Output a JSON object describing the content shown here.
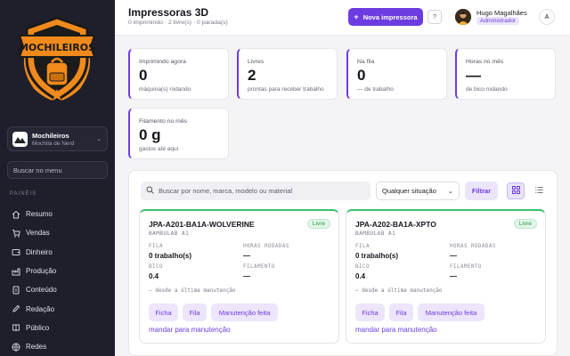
{
  "sidebar": {
    "logo_text": "MOCHILEIROS",
    "workspace_name": "Mochileiros",
    "workspace_sub": "Mochila de Nerd",
    "search_placeholder": "Buscar no menu",
    "section_label": "PAINÉIS",
    "items": [
      {
        "label": "Resumo",
        "icon": "home-icon"
      },
      {
        "label": "Vendas",
        "icon": "cart-icon"
      },
      {
        "label": "Dinheiro",
        "icon": "wallet-icon"
      },
      {
        "label": "Produção",
        "icon": "factory-icon"
      },
      {
        "label": "Conteúdo",
        "icon": "document-icon"
      },
      {
        "label": "Redação",
        "icon": "pencil-icon"
      },
      {
        "label": "Público",
        "icon": "book-icon"
      },
      {
        "label": "Redes",
        "icon": "globe-icon"
      }
    ]
  },
  "header": {
    "title": "Impressoras 3D",
    "subtitle": "0 imprimindo · 2 livre(s) · 0 parada(s)",
    "new_button": "Nova impressora",
    "user_name": "Hugo Magalhães",
    "user_role": "Administrador",
    "lang": "A"
  },
  "stats": [
    {
      "label": "Imprimindo agora",
      "value": "0",
      "sub": "máquina(s) rodando"
    },
    {
      "label": "Livres",
      "value": "2",
      "sub": "prontas para receber trabalho"
    },
    {
      "label": "Na fila",
      "value": "0",
      "sub": "— de trabalho"
    },
    {
      "label": "Horas no mês",
      "value": "—",
      "sub": "de bico rodando"
    },
    {
      "label": "Filamento no mês",
      "value": "0 g",
      "sub": "gastos até aqui"
    }
  ],
  "toolbar": {
    "search_placeholder": "Buscar por nome, marca, modelo ou material",
    "status_select": "Qualquer situação",
    "filter_button": "Filtrar"
  },
  "printers": [
    {
      "name": "JPA-A201-BA1A-WOLVERINE",
      "model": "BAMBULAB A1",
      "status": "Livre",
      "queue_label": "FILA",
      "queue_value": "0 trabalho(s)",
      "hours_label": "HORAS RODADAS",
      "hours_value": "—",
      "nozzle_label": "BICO",
      "nozzle_value": "0.4",
      "filament_label": "FILAMENTO",
      "filament_value": "—",
      "note": "— desde a última manutenção",
      "btn_sheet": "Ficha",
      "btn_queue": "Fila",
      "btn_maint_done": "Manutenção feita",
      "send_maint": "mandar para manutenção"
    },
    {
      "name": "JPA-A202-BA1A-XPTO",
      "model": "BAMBULAB A1",
      "status": "Livre",
      "queue_label": "FILA",
      "queue_value": "0 trabalho(s)",
      "hours_label": "HORAS RODADAS",
      "hours_value": "—",
      "nozzle_label": "BICO",
      "nozzle_value": "0.4",
      "filament_label": "FILAMENTO",
      "filament_value": "—",
      "note": "— desde a última manutenção",
      "btn_sheet": "Ficha",
      "btn_queue": "Fila",
      "btn_maint_done": "Manutenção feita",
      "send_maint": "mandar para manutenção"
    }
  ],
  "colors": {
    "accent": "#6c3ce0",
    "sidebar_bg": "#1e1f2b",
    "free_green": "#3dbf6e",
    "logo_orange": "#f08a1c"
  }
}
